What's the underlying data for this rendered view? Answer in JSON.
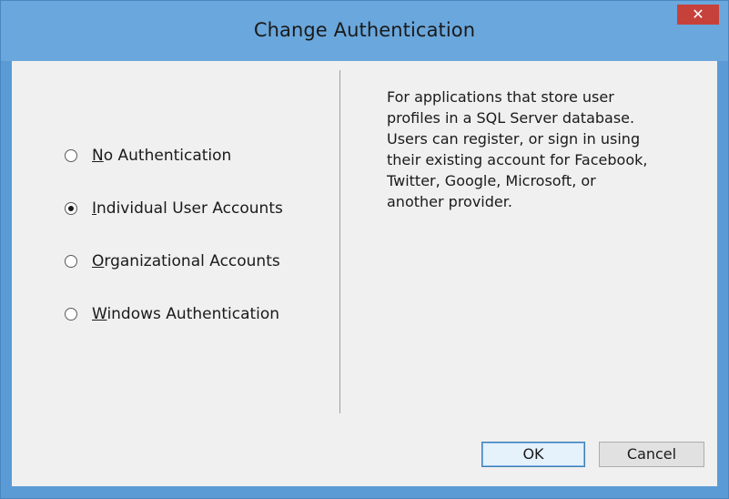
{
  "dialog": {
    "title": "Change Authentication",
    "close_label": "✕"
  },
  "options": [
    {
      "accel": "N",
      "rest": "o Authentication",
      "selected": false
    },
    {
      "accel": "I",
      "rest": "ndividual User Accounts",
      "selected": true
    },
    {
      "accel": "O",
      "rest": "rganizational Accounts",
      "selected": false
    },
    {
      "accel": "W",
      "rest": "indows Authentication",
      "selected": false
    }
  ],
  "description": [
    "For applications that store user",
    "profiles in a SQL Server database.",
    "Users can register, or sign in using",
    "their existing account for Facebook,",
    "Twitter, Google, Microsoft, or",
    "another provider."
  ],
  "buttons": {
    "ok_label": "OK",
    "cancel_label": "Cancel"
  },
  "colors": {
    "titlebar": "#6aa7dc",
    "close": "#c7413b",
    "client": "#f0f0f0"
  }
}
